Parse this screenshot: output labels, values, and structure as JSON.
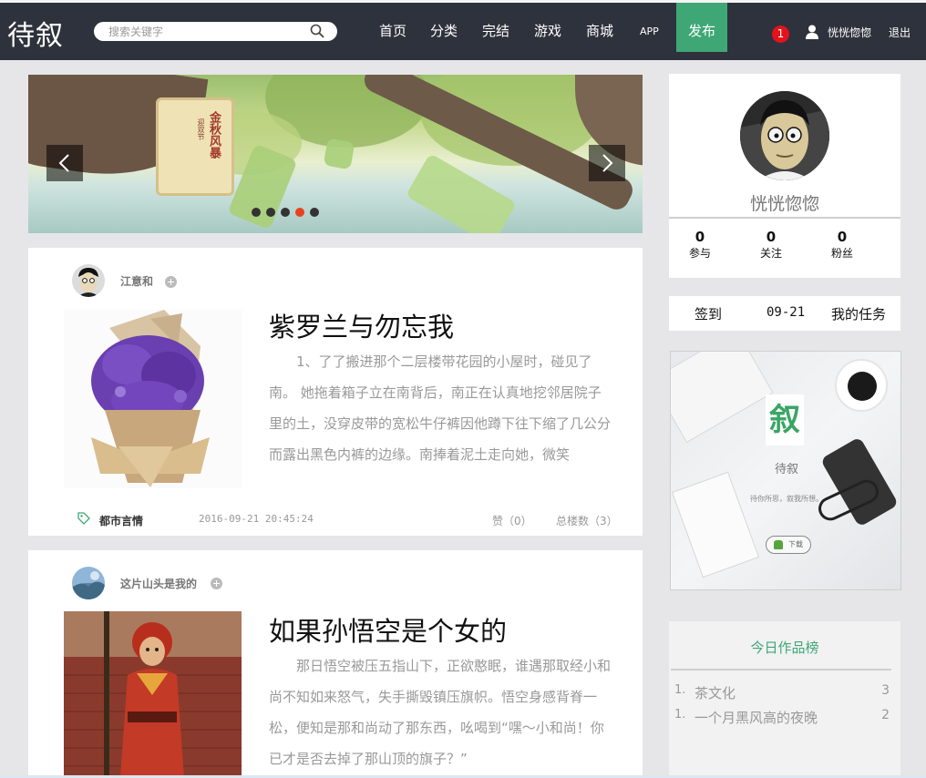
{
  "header": {
    "logo": "待叙",
    "search_placeholder": "搜索关键字",
    "nav": [
      "首页",
      "分类",
      "完结",
      "游戏",
      "商城",
      "APP"
    ],
    "publish_label": "发布",
    "notification_count": "1",
    "username": "恍恍惚惚",
    "logout_label": "退出",
    "accent_color": "#3fa776",
    "bg_color": "#2d323c"
  },
  "banner": {
    "card_title": "金秋风暴",
    "card_sub": "迎双节",
    "slide_count": 5,
    "active_slide": 4
  },
  "articles": [
    {
      "author": "江意和",
      "title": "紫罗兰与勿忘我",
      "excerpt": "1、了了搬进那个二层楼带花园的小屋时，碰见了南。 她拖着箱子立在南背后，南正在认真地挖邻居院子里的土，没穿皮带的宽松牛仔裤因他蹲下往下缩了几公分而露出黑色内裤的边缘。南捧着泥土走向她，微笑",
      "tag": "都市言情",
      "datetime": "2016-09-21 20:45:24",
      "likes_label": "赞（0）",
      "floors_label": "总楼数（3）"
    },
    {
      "author": "这片山头是我的",
      "title": "如果孙悟空是个女的",
      "excerpt": "那日悟空被压五指山下，正欲憨眠，谁遇那取经小和尚不知如来怒气，失手撕毁镇压旗帜。悟空身感背脊一松，便知是那和尚动了那东西，吆喝到“嘿～小和尚！你已才是否去掉了那山顶的旗子？”"
    }
  ],
  "profile": {
    "name": "恍恍惚惚",
    "stats": [
      {
        "num": "0",
        "label": "参与"
      },
      {
        "num": "0",
        "label": "关注"
      },
      {
        "num": "0",
        "label": "粉丝"
      }
    ]
  },
  "signbar": {
    "sign_label": "签到",
    "date": "09-21",
    "tasks_label": "我的任务"
  },
  "ad": {
    "logo_char": "叙",
    "app_name": "待叙",
    "slogan": "待你所思，叙我所想。",
    "download_label": "下载"
  },
  "ranking": {
    "title": "今日作品榜",
    "items": [
      {
        "index": "1.",
        "name": "茶文化",
        "count": "3"
      },
      {
        "index": "1.",
        "name": "一个月黑风高的夜晚",
        "count": "2"
      }
    ]
  }
}
